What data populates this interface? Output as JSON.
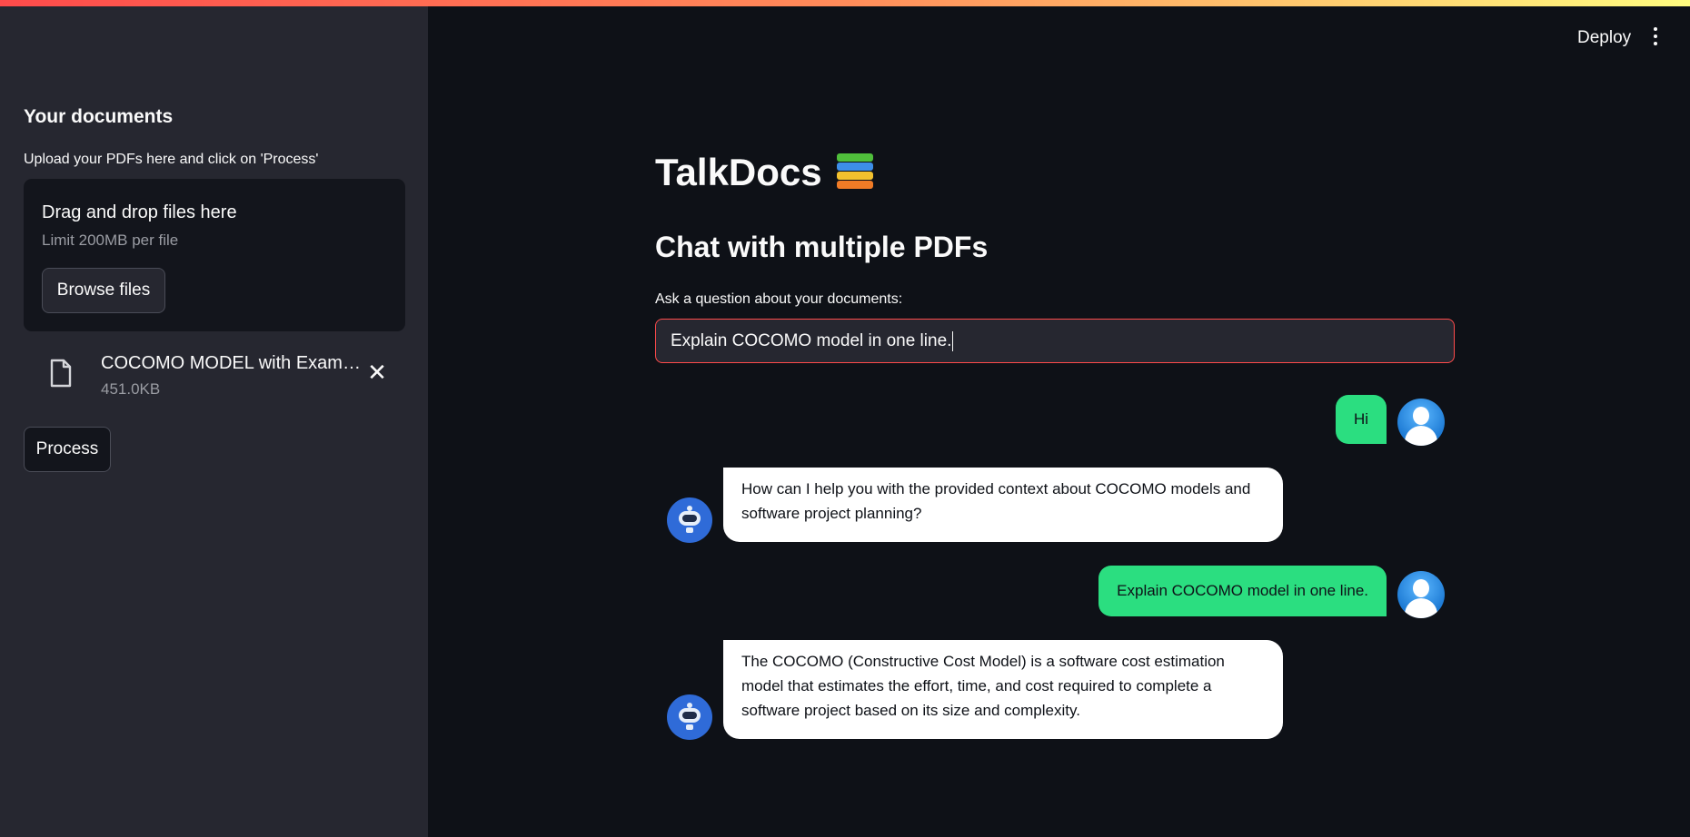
{
  "sidebar": {
    "title": "Your documents",
    "upload_label": "Upload your PDFs here and click on 'Process'",
    "dropzone": {
      "title": "Drag and drop files here",
      "limit": "Limit 200MB per file",
      "browse_label": "Browse files"
    },
    "file": {
      "name": "COCOMO MODEL with Exampl...",
      "size": "451.0KB",
      "icon": "file-icon"
    },
    "process_label": "Process"
  },
  "header": {
    "deploy_label": "Deploy",
    "menu_icon": "kebab-menu-icon"
  },
  "main": {
    "title": "TalkDocs",
    "title_icon": "books-emoji",
    "subtitle": "Chat with multiple PDFs",
    "ask_label": "Ask a question about your documents:",
    "ask_value": "Explain COCOMO model in one line."
  },
  "chat": [
    {
      "role": "user",
      "text": "Hi"
    },
    {
      "role": "bot",
      "text": "How can I help you with the provided context about COCOMO models and software project planning?"
    },
    {
      "role": "user",
      "text": "Explain COCOMO model in one line."
    },
    {
      "role": "bot",
      "text": "The COCOMO (Constructive Cost Model) is a software cost estimation model that estimates the effort, time, and cost required to complete a software project based on its size and complexity."
    }
  ],
  "colors": {
    "accent": "#ff4b4b",
    "user_bubble": "#2bde80",
    "bot_bubble": "#ffffff",
    "sidebar_bg": "#262730",
    "main_bg": "#0e1117"
  }
}
